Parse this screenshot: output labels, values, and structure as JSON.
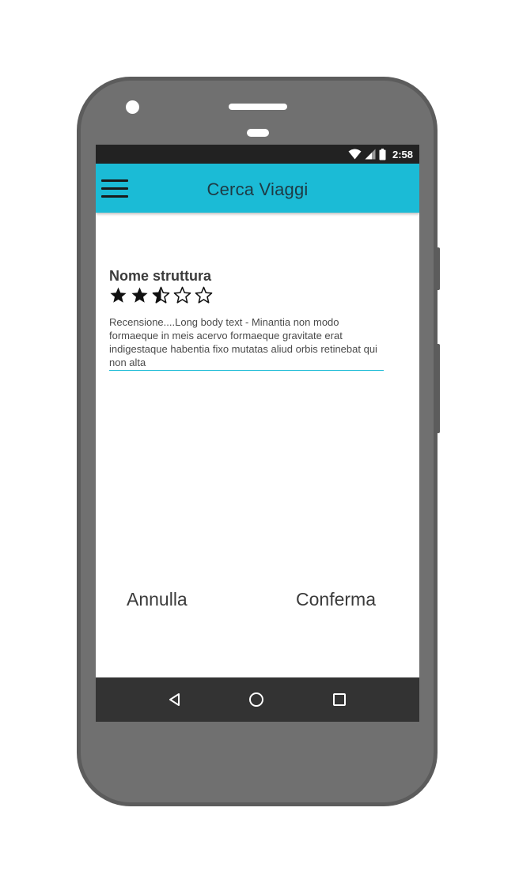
{
  "status_bar": {
    "time": "2:58",
    "icons": [
      "wifi-icon",
      "signal-icon",
      "battery-icon"
    ]
  },
  "app_bar": {
    "title": "Cerca Viaggi",
    "menu_icon": "hamburger-menu-icon",
    "color": "#1bbbd6"
  },
  "review_card": {
    "structure_name": "Nome struttura",
    "rating": 2.5,
    "max_rating": 5,
    "review_text": "Recensione....Long body text - Minantia non modo formaeque in meis acervo formaeque gravitate erat indigestaque habentia fixo mutatas aliud orbis retinebat qui non alta"
  },
  "actions": {
    "cancel_label": "Annulla",
    "confirm_label": "Conferma"
  },
  "nav_bar": {
    "icons": [
      "back-icon",
      "home-icon",
      "recent-apps-icon"
    ]
  }
}
